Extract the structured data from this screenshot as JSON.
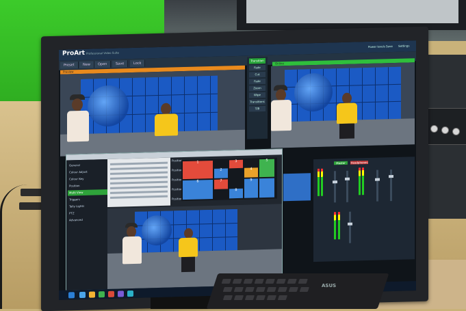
{
  "app": {
    "brand": "ProArt",
    "brand_sub": "Professional Video Suite"
  },
  "toolbar": {
    "items": [
      "Preset",
      "New",
      "Open",
      "Save",
      "Lock",
      "Ref"
    ]
  },
  "topbar_right": {
    "items": [
      "Power levels",
      "Save",
      "Settings"
    ]
  },
  "preview": {
    "label": "Preview"
  },
  "program": {
    "label": "Online"
  },
  "controls": {
    "items": [
      "Fade",
      "Cut",
      "Fade",
      "Zoom",
      "Wipe",
      "Transitions",
      "T/B"
    ],
    "highlight": "Transition"
  },
  "overlay": {
    "sidebar": [
      "General",
      "Colour Adjust",
      "Colour Key",
      "Position",
      "Multi View",
      "Triggers",
      "Tally Lights",
      "PTZ",
      "Advanced"
    ],
    "active_item": "Multi View",
    "mid_labels": [
      "Position",
      "Position",
      "Position",
      "Position",
      "Position",
      "Position",
      "Position",
      "Position",
      "Position",
      "Position"
    ]
  },
  "grid": {
    "cells": [
      {
        "n": "1",
        "color": "#e34b3b"
      },
      {
        "n": "2",
        "color": "#3a83d9"
      },
      {
        "n": "3",
        "color": "#e34b3b"
      },
      {
        "n": "4",
        "color": "#e9a12a"
      },
      {
        "n": "5",
        "color": "#3fb34f"
      },
      {
        "n": "6",
        "color": "#3a83d9"
      },
      {
        "n": "7",
        "color": "#e34b3b"
      },
      {
        "n": "8",
        "color": "#3a83d9"
      },
      {
        "n": "9",
        "color": "#3a83d9"
      },
      {
        "n": "",
        "color": "#3a83d9"
      }
    ]
  },
  "mixer": {
    "tabs": [
      "Master",
      "Headphones"
    ]
  },
  "keyboard_brand": "ASUS",
  "colors": {
    "accent_orange": "#e98a1d",
    "accent_green": "#2fbf3c",
    "video_blue": "#1b5ac4"
  }
}
